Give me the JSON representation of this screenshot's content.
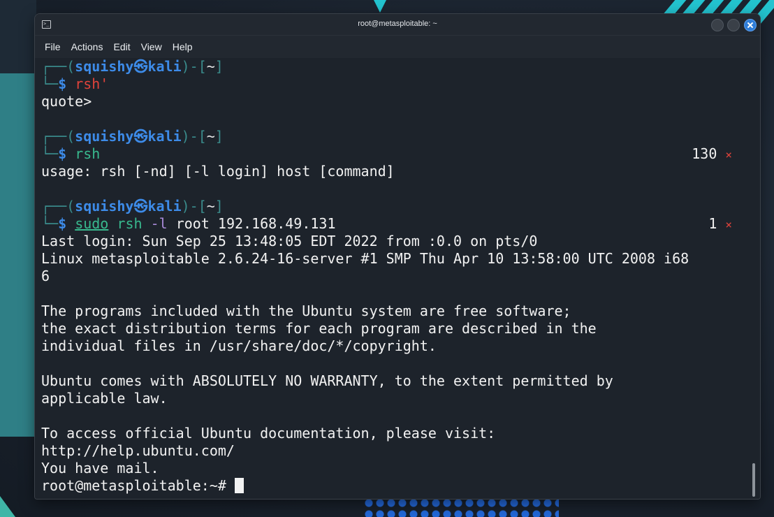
{
  "window": {
    "title": "root@metasploitable: ~",
    "icon_glyph": ">_"
  },
  "menu": [
    "File",
    "Actions",
    "Edit",
    "View",
    "Help"
  ],
  "prompt": {
    "frame_open": "┌──(",
    "user": "squishy㉿kali",
    "frame_mid": ")-[",
    "dir": "~",
    "frame_close": "]",
    "frame_bottom": "└─",
    "dollar": "$ "
  },
  "block1": {
    "command": "rsh'",
    "output": "quote>"
  },
  "block2": {
    "command": "rsh",
    "status_code": "130",
    "status_icon": "×",
    "output": "usage: rsh [-nd] [-l login] host [command]"
  },
  "block3": {
    "cmd_sudo": "sudo",
    "cmd_rsh": "rsh",
    "cmd_opt": "-l",
    "cmd_args": "root 192.168.49.131",
    "status_code": "1",
    "status_icon": "×"
  },
  "output": [
    "Last login: Sun Sep 25 13:48:05 EDT 2022 from :0.0 on pts/0",
    "Linux metasploitable 2.6.24-16-server #1 SMP Thu Apr 10 13:58:00 UTC 2008 i68",
    "6",
    "",
    "The programs included with the Ubuntu system are free software;",
    "the exact distribution terms for each program are described in the",
    "individual files in /usr/share/doc/*/copyright.",
    "",
    "Ubuntu comes with ABSOLUTELY NO WARRANTY, to the extent permitted by",
    "applicable law.",
    "",
    "To access official Ubuntu documentation, please visit:",
    "http://help.ubuntu.com/",
    "You have mail."
  ],
  "final_prompt": "root@metasploitable:~# ",
  "colors": {
    "prompt_blue": "#3d8be8",
    "command_green": "#38b98e",
    "error_red": "#e0433b",
    "frame_teal": "#3a8c8c",
    "close_button": "#2f7dd8"
  }
}
